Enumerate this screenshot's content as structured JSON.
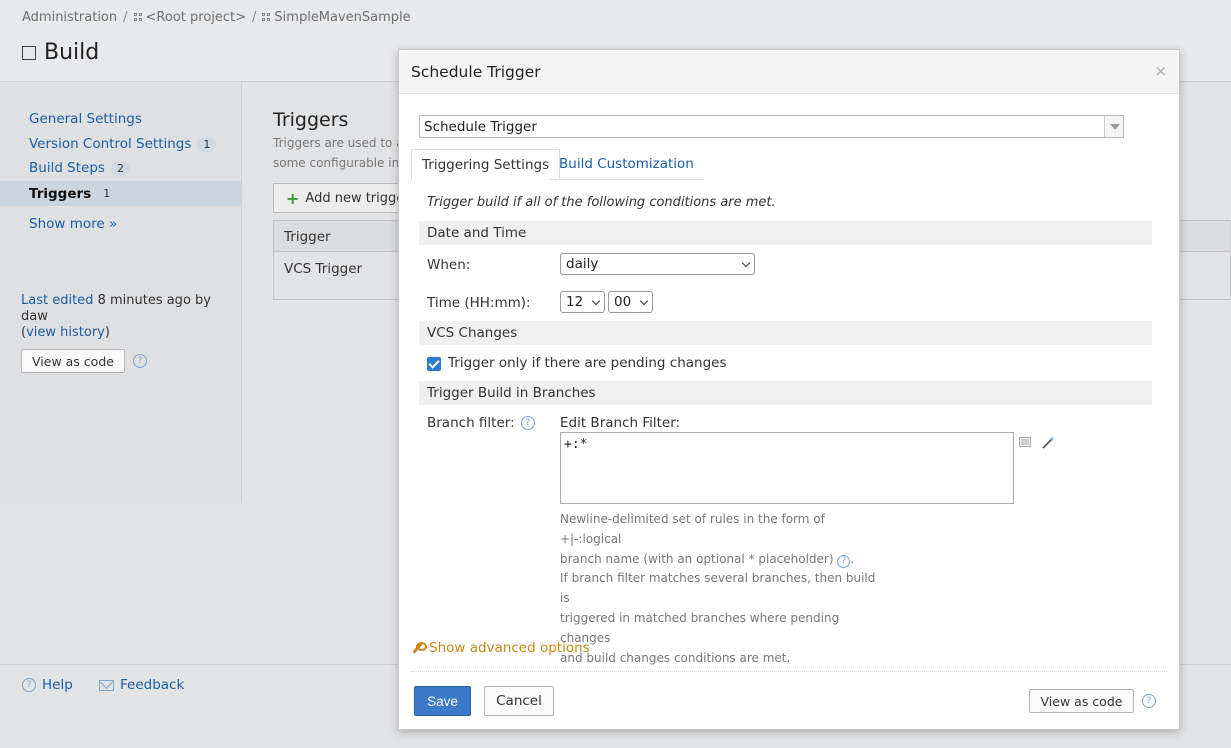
{
  "breadcrumb": {
    "items": [
      "Administration",
      "<Root project>",
      "SimpleMavenSample"
    ],
    "separator": "/"
  },
  "page": {
    "title": "Build"
  },
  "sidebar": {
    "items": [
      {
        "label": "General Settings",
        "badge": ""
      },
      {
        "label": "Version Control Settings",
        "badge": "1"
      },
      {
        "label": "Build Steps",
        "badge": "2"
      },
      {
        "label": "Triggers",
        "badge": "1"
      }
    ],
    "show_more": "Show more »",
    "last_edited_prefix": "Last edited",
    "last_edited_when": "8 minutes ago by daw",
    "view_history": "view history",
    "view_as_code": "View as code"
  },
  "main": {
    "heading": "Triggers",
    "description_line1": "Triggers are used to ad",
    "description_line2": "some configurable inte",
    "add_trigger": "Add new trigge",
    "table": {
      "header": "Trigger",
      "rows": [
        "VCS Trigger"
      ]
    }
  },
  "footer": {
    "help": "Help",
    "feedback": "Feedback"
  },
  "dialog": {
    "title": "Schedule Trigger",
    "close": "×",
    "trigger_type": "Schedule Trigger",
    "tabs": [
      "Triggering Settings",
      "Build Customization"
    ],
    "intro": "Trigger build if all of the following conditions are met.",
    "sections": {
      "date_time": "Date and Time",
      "vcs_changes": "VCS Changes",
      "branches": "Trigger Build in Branches"
    },
    "when_label": "When:",
    "when_value": "daily",
    "time_label": "Time (HH:mm):",
    "hour": "12",
    "minute": "00",
    "pending_changes_label": "Trigger only if there are pending changes",
    "pending_changes_checked": true,
    "branch_filter_label": "Branch filter:",
    "edit_branch_filter": "Edit Branch Filter:",
    "branch_filter_value": "+:*",
    "note_line1": "Newline-delimited set of rules in the form of +|-:logical",
    "note_line2": "branch name (with an optional * placeholder)",
    "note_line2_end": ".",
    "note_line3": "If branch filter matches several branches, then build is",
    "note_line4": "triggered in matched branches where pending changes",
    "note_line5": "and build changes conditions are met.",
    "advanced": "Show advanced options",
    "save": "Save",
    "cancel": "Cancel",
    "view_as_code": "View as code"
  },
  "colors": {
    "link": "#1a5ea4",
    "primary_button": "#3a7ac8",
    "advanced_link": "#c6891a",
    "checkbox": "#2e7ad1"
  }
}
